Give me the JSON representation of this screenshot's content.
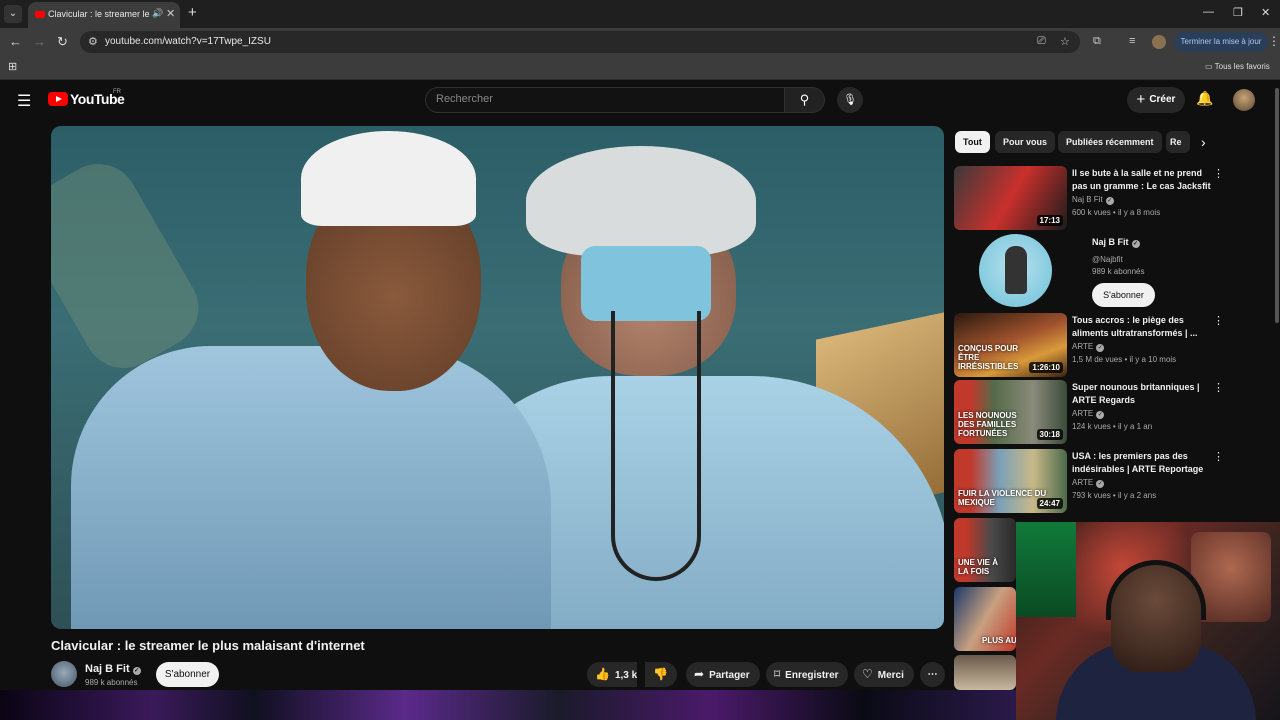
{
  "browser": {
    "tab_title": "Clavicular : le streamer le plus malaisant d'internet",
    "url": "youtube.com/watch?v=17Twpe_IZSU",
    "update_button": "Terminer la mise à jour",
    "bookmarks_folder": "Tous les favoris"
  },
  "masthead": {
    "logo": "YouTube",
    "country_code": "FR",
    "search_placeholder": "Rechercher",
    "create_label": "Créer"
  },
  "video": {
    "title": "Clavicular : le streamer le plus malaisant d'internet",
    "channel": "Naj B Fit",
    "subscribers": "989 k abonnés",
    "subscribe_label": "S'abonner",
    "likes": "1,3 k",
    "share_label": "Partager",
    "save_label": "Enregistrer",
    "thanks_label": "Merci"
  },
  "chips": [
    "Tout",
    "Pour vous",
    "Publiées récemment",
    "Re"
  ],
  "recommendations": [
    {
      "title": "Il se bute à la salle et ne prend pas un gramme : Le cas Jacksfit",
      "channel": "Naj B Fit",
      "views": "600 k vues",
      "age": "il y a 8 mois",
      "duration": "17:13",
      "overlay": ""
    },
    {
      "title": "Tous accros : le piège des aliments ultratransformés | ...",
      "channel": "ARTE",
      "views": "1,5 M de vues",
      "age": "il y a 10 mois",
      "duration": "1:26:10",
      "overlay": "Conçus pour être irrésistibles"
    },
    {
      "title": "Super nounous britanniques | ARTE Regards",
      "channel": "ARTE",
      "views": "124 k vues",
      "age": "il y a 1 an",
      "duration": "30:18",
      "overlay": "Les nounous des familles fortunées"
    },
    {
      "title": "USA : les premiers pas des indésirables | ARTE Reportage",
      "channel": "ARTE",
      "views": "793 k vues",
      "age": "il y a 2 ans",
      "duration": "24:47",
      "overlay": "Fuir la violence du Mexique"
    }
  ],
  "channel_card": {
    "name": "Naj B Fit",
    "handle": "@Najbfit",
    "subscribers": "989 k abonnés",
    "subscribe_label": "S'abonner"
  },
  "partial_thumbs": [
    {
      "overlay": "Une vie à la fois"
    },
    {
      "overlay": "Plus au"
    }
  ],
  "colors": {
    "yt_red": "#ff0000",
    "background": "#0f0f0f",
    "chip_active": "#f1f1f1",
    "update_button": "#a8c7fa"
  }
}
